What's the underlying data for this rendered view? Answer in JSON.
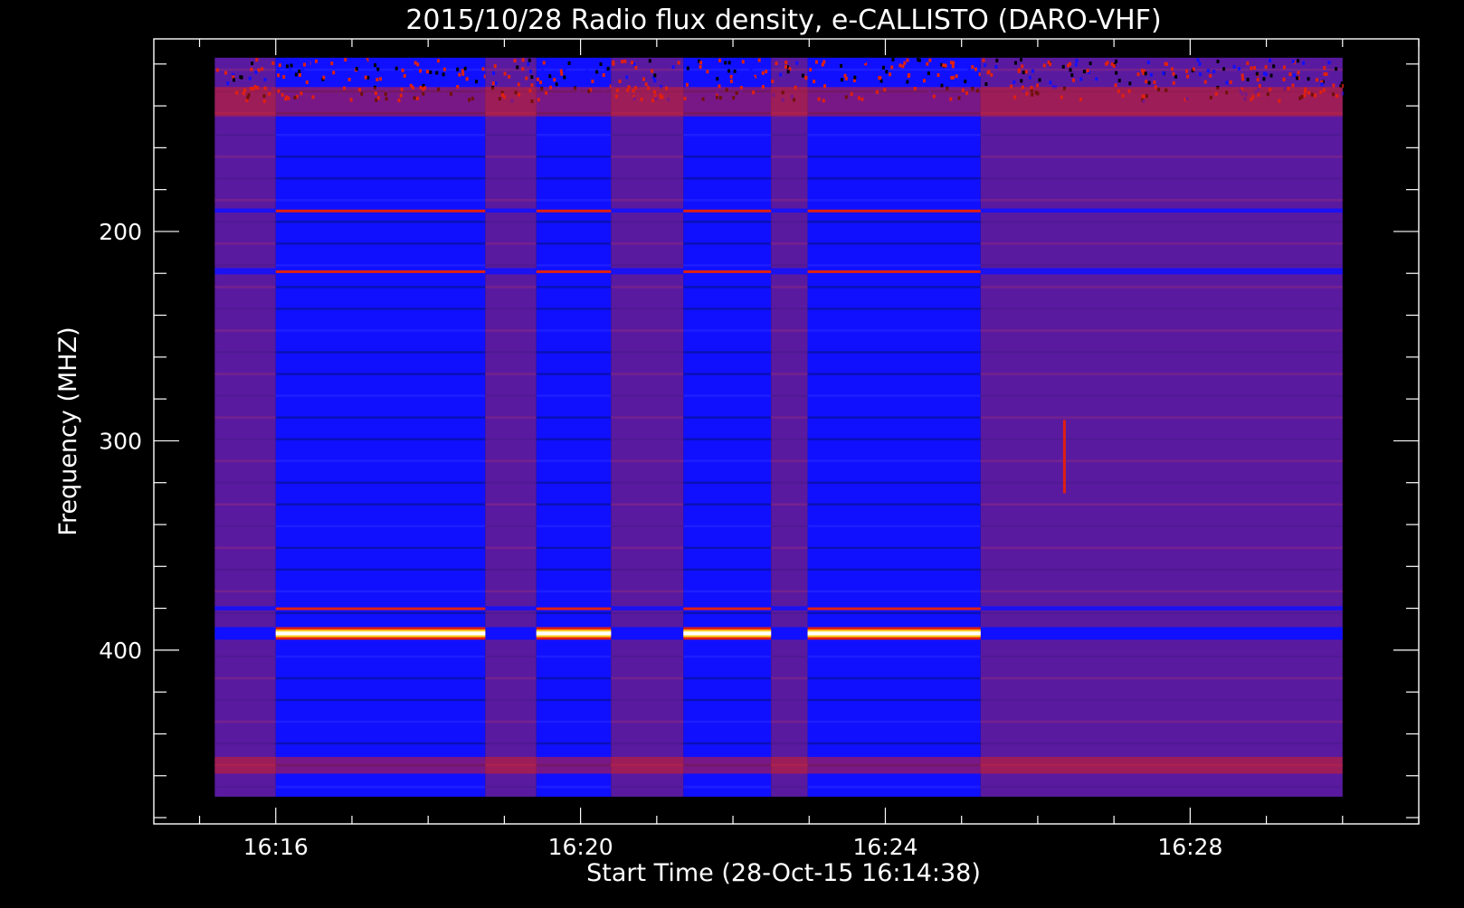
{
  "chart_data": {
    "type": "heatmap",
    "title": "2015/10/28  Radio flux density, e-CALLISTO (DARO-VHF)",
    "xlabel": "Start Time (28-Oct-15 16:14:38)",
    "ylabel": "Frequency (MHZ)",
    "x_unit": "minutes after 16:00",
    "x_ticks": [
      {
        "label": "16:16",
        "value": 16
      },
      {
        "label": "16:20",
        "value": 20
      },
      {
        "label": "16:24",
        "value": 24
      },
      {
        "label": "16:28",
        "value": 28
      }
    ],
    "y_ticks": [
      200,
      300,
      400
    ],
    "xlim": [
      14.4,
      31.0
    ],
    "ylim": [
      108,
      483
    ],
    "y_inverted": true,
    "data_extent": {
      "x": [
        15.2,
        30.0
      ],
      "y": [
        117,
        470
      ]
    },
    "colorscale": [
      "#000000",
      "#05107a",
      "#1010ff",
      "#5a1aa0",
      "#8a2a80",
      "#e02010",
      "#ffd020",
      "#ffffff"
    ],
    "time_segments": [
      {
        "start": 15.2,
        "end": 16.0,
        "level": "background"
      },
      {
        "start": 16.0,
        "end": 18.75,
        "level": "quiet"
      },
      {
        "start": 18.75,
        "end": 19.42,
        "level": "background"
      },
      {
        "start": 19.42,
        "end": 20.4,
        "level": "quiet"
      },
      {
        "start": 20.4,
        "end": 21.35,
        "level": "background"
      },
      {
        "start": 21.35,
        "end": 22.5,
        "level": "quiet"
      },
      {
        "start": 22.5,
        "end": 22.98,
        "level": "background"
      },
      {
        "start": 22.98,
        "end": 25.25,
        "level": "quiet"
      },
      {
        "start": 25.25,
        "end": 30.0,
        "level": "background"
      }
    ],
    "frequency_features": [
      {
        "freq": 138,
        "width": 14,
        "kind": "interference"
      },
      {
        "freq": 190,
        "width": 2,
        "kind": "line"
      },
      {
        "freq": 219,
        "width": 3,
        "kind": "line"
      },
      {
        "freq": 380,
        "width": 2,
        "kind": "line"
      },
      {
        "freq": 392,
        "width": 6,
        "kind": "strong-line"
      },
      {
        "freq": 455,
        "width": 8,
        "kind": "interference"
      }
    ],
    "burst": {
      "time": 26.35,
      "freq_start": 290,
      "freq_end": 325
    }
  }
}
